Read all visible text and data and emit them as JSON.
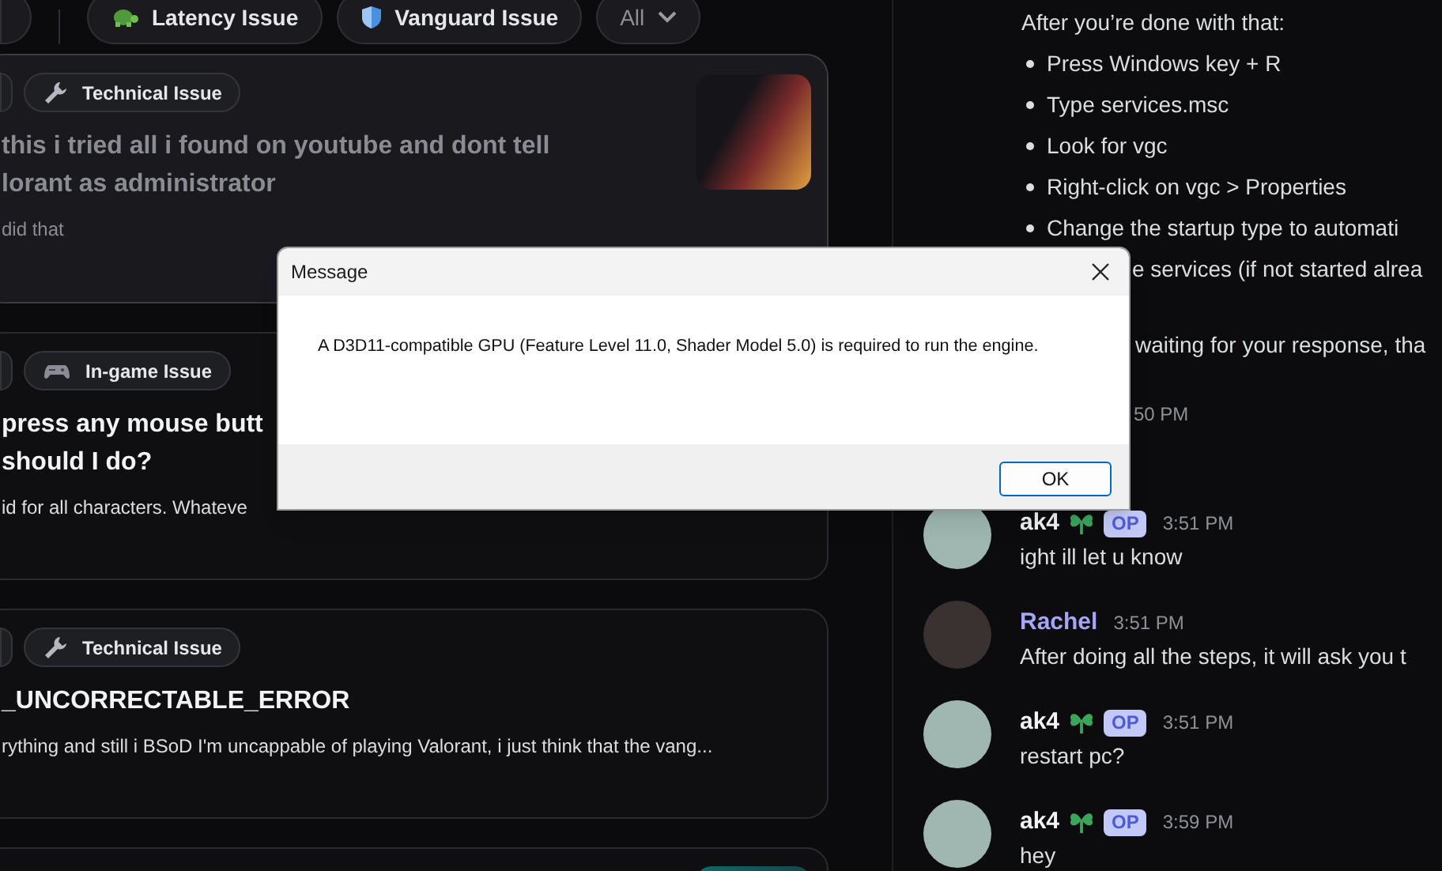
{
  "filters": [
    {
      "kind": "tag",
      "label": "Latency Issue"
    },
    {
      "kind": "tag",
      "label": "Vanguard Issue"
    },
    {
      "kind": "dropdown",
      "label": "All"
    }
  ],
  "cards": [
    {
      "selected": true,
      "read": true,
      "tag": "Technical Issue",
      "title_lines": [
        "this i tried all i found on youtube and dont tell",
        "lorant as administrator"
      ],
      "preview": "did that",
      "has_thumbnail": true
    },
    {
      "selected": false,
      "read": false,
      "tag": "In-game Issue",
      "title_lines": [
        "press any mouse butt",
        "should I do?"
      ],
      "preview": "id for all characters. Whateve",
      "has_thumbnail": false
    },
    {
      "selected": false,
      "read": false,
      "tag": "Technical Issue",
      "title_lines": [
        "_UNCORRECTABLE_ERROR"
      ],
      "preview": "rything and still i BSoD I'm uncappable of playing Valorant, i just think that the vang...",
      "has_thumbnail": false
    },
    {
      "selected": false,
      "has_thumbnail": true
    }
  ],
  "chat": {
    "intro": "After you’re done with that:",
    "bullets": [
      "Press Windows key + R",
      "Type services.msc",
      "Look for vgc",
      "Right-click on vgc > Properties",
      "Change the startup type to automati"
    ],
    "fragments": [
      "e services (if not started alrea",
      "waiting for your response, tha",
      "50 PM"
    ],
    "messages": [
      {
        "author": "ak4",
        "color": "#f2f3f5",
        "op": true,
        "badge": "OP",
        "time": "3:51 PM",
        "text": "ight ill let u know"
      },
      {
        "author": "Rachel",
        "color": "#a5a6f6",
        "op": false,
        "time": "3:51 PM",
        "text": "After doing all the steps, it will ask you t"
      },
      {
        "author": "ak4",
        "color": "#f2f3f5",
        "op": true,
        "badge": "OP",
        "time": "3:51 PM",
        "text": "restart pc?"
      },
      {
        "author": "ak4",
        "color": "#f2f3f5",
        "op": true,
        "badge": "OP",
        "time": "3:59 PM",
        "text": "hey"
      }
    ]
  },
  "dialog": {
    "title": "Message",
    "text": "A D3D11-compatible GPU (Feature Level 11.0, Shader Model 5.0) is required to run the engine.",
    "button": "OK"
  }
}
